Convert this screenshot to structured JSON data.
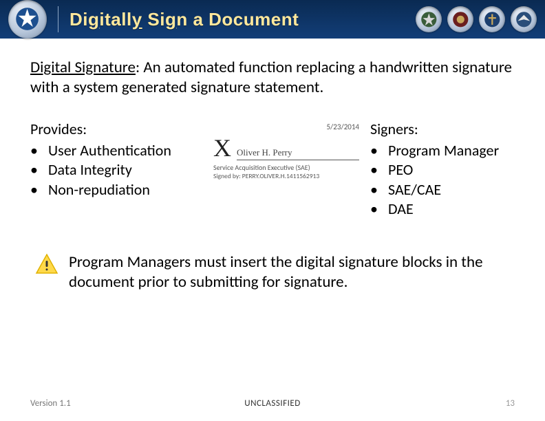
{
  "header": {
    "title_html": "Di<u>g</u>itall<u>y</u> Si<u>g</u>n a Document"
  },
  "definition": {
    "term": "Digital Signature",
    "text": ":  An automated function replacing a handwritten signature with a system generated signature statement."
  },
  "provides": {
    "heading": "Provides:",
    "items": [
      "User Authentication",
      "Data Integrity",
      "Non-repudiation"
    ]
  },
  "signature_sample": {
    "date": "5/23/2014",
    "x": "X",
    "name": "Oliver H. Perry",
    "role": "Service Acquisition Executive (SAE)",
    "signed_by": "Signed by:  PERRY.OLIVER.H.1411562913"
  },
  "signers": {
    "heading": "Signers:",
    "items": [
      "Program Manager",
      "PEO",
      "SAE/CAE",
      "DAE"
    ]
  },
  "note": "Program Managers must insert the digital signature blocks in the document prior to submitting for signature.",
  "footer": {
    "version": "Version 1.1",
    "classification": "UNCLASSIFIED",
    "page": "13"
  }
}
